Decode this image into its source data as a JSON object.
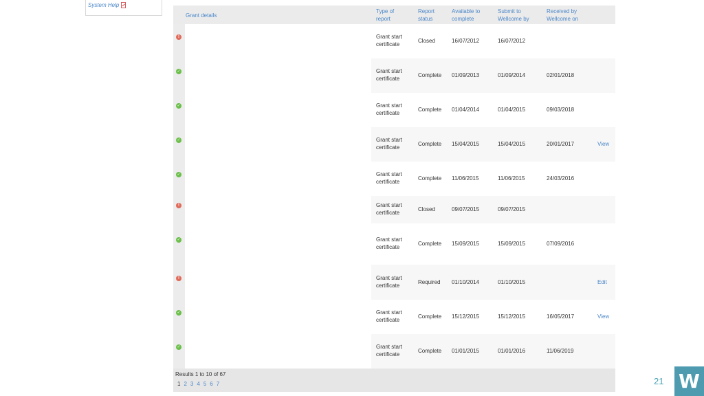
{
  "sidebar": {
    "help_link": "System Help",
    "help_icon": "pdf-icon"
  },
  "table": {
    "headers": {
      "grant_details": "Grant details",
      "type_1": "Type of",
      "type_2": "report",
      "status_1": "Report",
      "status_2": "status",
      "avail_1": "Available to",
      "avail_2": "complete",
      "submit_1": "Submit to",
      "submit_2": "Wellcome by",
      "recv_1": "Received by",
      "recv_2": "Wellcome on"
    },
    "rows": [
      {
        "icon": "error-icon",
        "type_1": "Grant start",
        "type_2": "certificate",
        "status": "Closed",
        "available": "16/07/2012",
        "submit_by": "16/07/2012",
        "received_on": "",
        "action": ""
      },
      {
        "icon": "check-icon",
        "type_1": "Grant start",
        "type_2": "certificate",
        "status": "Complete",
        "available": "01/09/2013",
        "submit_by": "01/09/2014",
        "received_on": "02/01/2018",
        "action": ""
      },
      {
        "icon": "check-icon",
        "type_1": "Grant start",
        "type_2": "certificate",
        "status": "Complete",
        "available": "01/04/2014",
        "submit_by": "01/04/2015",
        "received_on": "09/03/2018",
        "action": ""
      },
      {
        "icon": "check-icon",
        "type_1": "Grant start",
        "type_2": "certificate",
        "status": "Complete",
        "available": "15/04/2015",
        "submit_by": "15/04/2015",
        "received_on": "20/01/2017",
        "action": "View"
      },
      {
        "icon": "check-icon",
        "type_1": "Grant start",
        "type_2": "certificate",
        "status": "Complete",
        "available": "11/06/2015",
        "submit_by": "11/06/2015",
        "received_on": "24/03/2016",
        "action": ""
      },
      {
        "icon": "error-icon",
        "type_1": "Grant start",
        "type_2": "certificate",
        "status": "Closed",
        "available": "09/07/2015",
        "submit_by": "09/07/2015",
        "received_on": "",
        "action": ""
      },
      {
        "icon": "check-icon",
        "type_1": "Grant start",
        "type_2": "certificate",
        "status": "Complete",
        "available": "15/09/2015",
        "submit_by": "15/09/2015",
        "received_on": "07/09/2016",
        "action": ""
      },
      {
        "icon": "error-icon",
        "type_1": "Grant start",
        "type_2": "certificate",
        "status": "Required",
        "available": "01/10/2014",
        "submit_by": "01/10/2015",
        "received_on": "",
        "action": "Edit"
      },
      {
        "icon": "check-icon",
        "type_1": "Grant start",
        "type_2": "certificate",
        "status": "Complete",
        "available": "15/12/2015",
        "submit_by": "15/12/2015",
        "received_on": "16/05/2017",
        "action": "View"
      },
      {
        "icon": "check-icon",
        "type_1": "Grant start",
        "type_2": "certificate",
        "status": "Complete",
        "available": "01/01/2015",
        "submit_by": "01/01/2016",
        "received_on": "11/06/2019",
        "action": ""
      }
    ],
    "results_text": "Results 1 to 10 of 67",
    "pages": [
      "1",
      "2",
      "3",
      "4",
      "5",
      "6",
      "7"
    ],
    "current_page": "1"
  },
  "slide_number": "21",
  "logo_letter": "W",
  "colors": {
    "link": "#4a86c8",
    "ok": "#6cbf4a",
    "error": "#e06b5a",
    "logo_bg": "#4e9bb0"
  }
}
